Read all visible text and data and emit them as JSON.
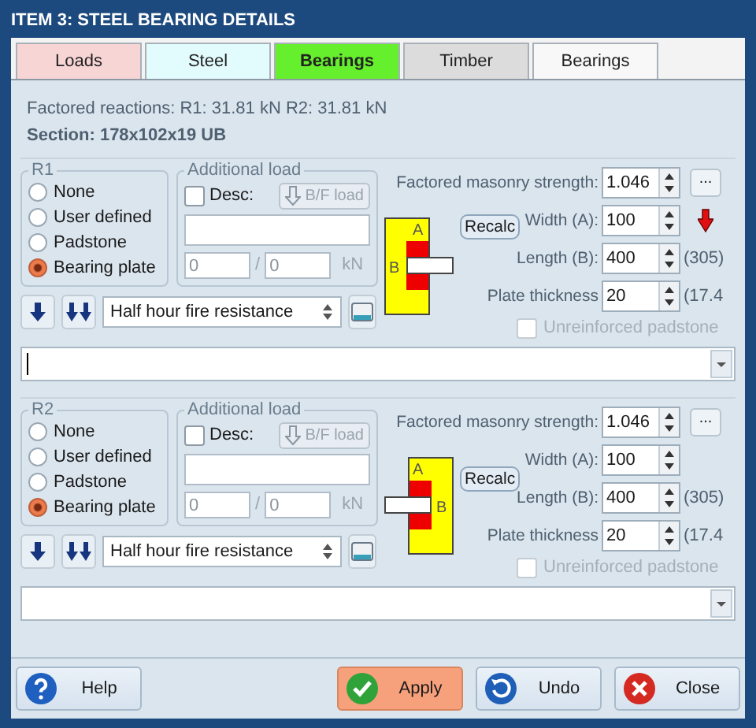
{
  "window": {
    "title": "ITEM 3: STEEL BEARING DETAILS"
  },
  "tabs": [
    {
      "label": "Loads",
      "color": "#f8d5d5",
      "selected": false
    },
    {
      "label": "Steel",
      "color": "#e2fbfd",
      "selected": false
    },
    {
      "label": "Bearings",
      "color": "#66ef2c",
      "selected": true
    },
    {
      "label": "Timber",
      "color": "#dcdcdc",
      "selected": false
    },
    {
      "label": "Bearings",
      "color": "#f8f8f8",
      "selected": false
    }
  ],
  "reactions": "Factored reactions:  R1: 31.81 kN   R2: 31.81 kN",
  "section": "Section: 178x102x19 UB",
  "bearings": [
    {
      "group": "R1",
      "mirrored": false,
      "options": [
        {
          "label": "None",
          "selected": false
        },
        {
          "label": "User defined",
          "selected": false
        },
        {
          "label": "Padstone",
          "selected": false
        },
        {
          "label": "Bearing plate",
          "selected": true
        }
      ],
      "additional_load": {
        "title": "Additional load",
        "desc": {
          "label": "Desc:",
          "checked": false
        },
        "bf_button": "B/F load",
        "value_1": "0",
        "separator": "/",
        "value_2": "0",
        "unit": "kN"
      },
      "masonry": {
        "label": "Factored masonry strength:",
        "value": "1.046"
      },
      "more_button": "...",
      "width": {
        "label": "Width (A):",
        "value": "100"
      },
      "warning": true,
      "length": {
        "label": "Length (B):",
        "value": "400",
        "note": "(305)"
      },
      "thickness": {
        "label": "Plate thickness",
        "value": "20",
        "note": "(17.4"
      },
      "diagram": {
        "label_a": "A",
        "label_b": "B"
      },
      "recalc": "Recalc",
      "unreinforced": {
        "label": "Unreinforced padstone",
        "checked": false,
        "disabled": true
      },
      "fire": "Half hour fire resistance"
    },
    {
      "group": "R2",
      "mirrored": true,
      "options": [
        {
          "label": "None",
          "selected": false
        },
        {
          "label": "User defined",
          "selected": false
        },
        {
          "label": "Padstone",
          "selected": false
        },
        {
          "label": "Bearing plate",
          "selected": true
        }
      ],
      "additional_load": {
        "title": "Additional load",
        "desc": {
          "label": "Desc:",
          "checked": false
        },
        "bf_button": "B/F load",
        "value_1": "0",
        "separator": "/",
        "value_2": "0",
        "unit": "kN"
      },
      "masonry": {
        "label": "Factored masonry strength:",
        "value": "1.046"
      },
      "more_button": "...",
      "width": {
        "label": "Width (A):",
        "value": "100"
      },
      "warning": false,
      "length": {
        "label": "Length (B):",
        "value": "400",
        "note": "(305)"
      },
      "thickness": {
        "label": "Plate thickness",
        "value": "20",
        "note": "(17.4"
      },
      "diagram": {
        "label_a": "A",
        "label_b": "B"
      },
      "recalc": "Recalc",
      "unreinforced": {
        "label": "Unreinforced padstone",
        "checked": false,
        "disabled": true
      },
      "fire": "Half hour fire resistance"
    }
  ],
  "buttons": [
    {
      "label": "Help",
      "kind": "help",
      "highlighted": false
    },
    {
      "label": "Apply",
      "kind": "apply",
      "highlighted": true
    },
    {
      "label": "Undo",
      "kind": "undo",
      "highlighted": false
    },
    {
      "label": "Close",
      "kind": "close",
      "highlighted": false
    }
  ]
}
